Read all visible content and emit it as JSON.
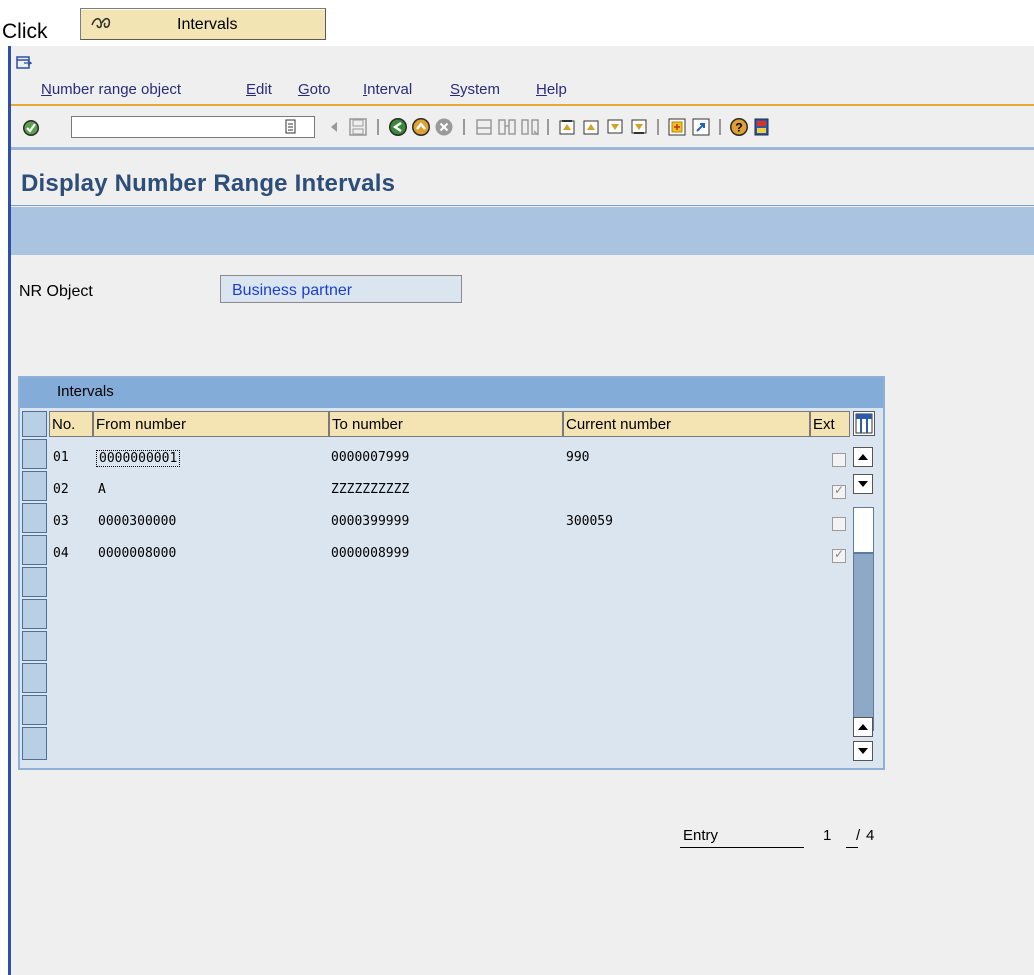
{
  "instruction": {
    "prefix": "Click",
    "button_label": "Intervals"
  },
  "menubar": {
    "items": [
      {
        "label": "Number range object",
        "ul": "N",
        "rest": "umber range object"
      },
      {
        "label": "Edit",
        "ul": "E",
        "rest": "dit"
      },
      {
        "label": "Goto",
        "ul": "G",
        "rest": "oto"
      },
      {
        "label": "Interval",
        "ul": "I",
        "rest": "nterval"
      },
      {
        "label": "System",
        "ul": "S",
        "rest": "ystem"
      },
      {
        "label": "Help",
        "ul": "H",
        "rest": "elp"
      }
    ]
  },
  "toolbar": {
    "command_field_value": ""
  },
  "page": {
    "title": "Display Number Range Intervals"
  },
  "nr_object": {
    "label": "NR Object",
    "value": "Business partner"
  },
  "table": {
    "title": "Intervals",
    "headers": {
      "no": "No.",
      "from": "From number",
      "to": "To number",
      "current": "Current number",
      "ext": "Ext"
    },
    "rows": [
      {
        "no": "01",
        "from": "0000000001",
        "to": "0000007999",
        "current": "990",
        "ext": false
      },
      {
        "no": "02",
        "from": "A",
        "to": "ZZZZZZZZZZ",
        "current": "",
        "ext": true
      },
      {
        "no": "03",
        "from": "0000300000",
        "to": "0000399999",
        "current": "300059",
        "ext": false
      },
      {
        "no": "04",
        "from": "0000008000",
        "to": "0000008999",
        "current": "",
        "ext": true
      }
    ]
  },
  "entry": {
    "label": "Entry",
    "current": "1",
    "separator": "/",
    "total": "4"
  },
  "colors": {
    "accent_orange": "#e9a838",
    "title_blue": "#2c4e78",
    "header_bg": "#f4e3b3",
    "table_bg": "#dae5f0"
  }
}
